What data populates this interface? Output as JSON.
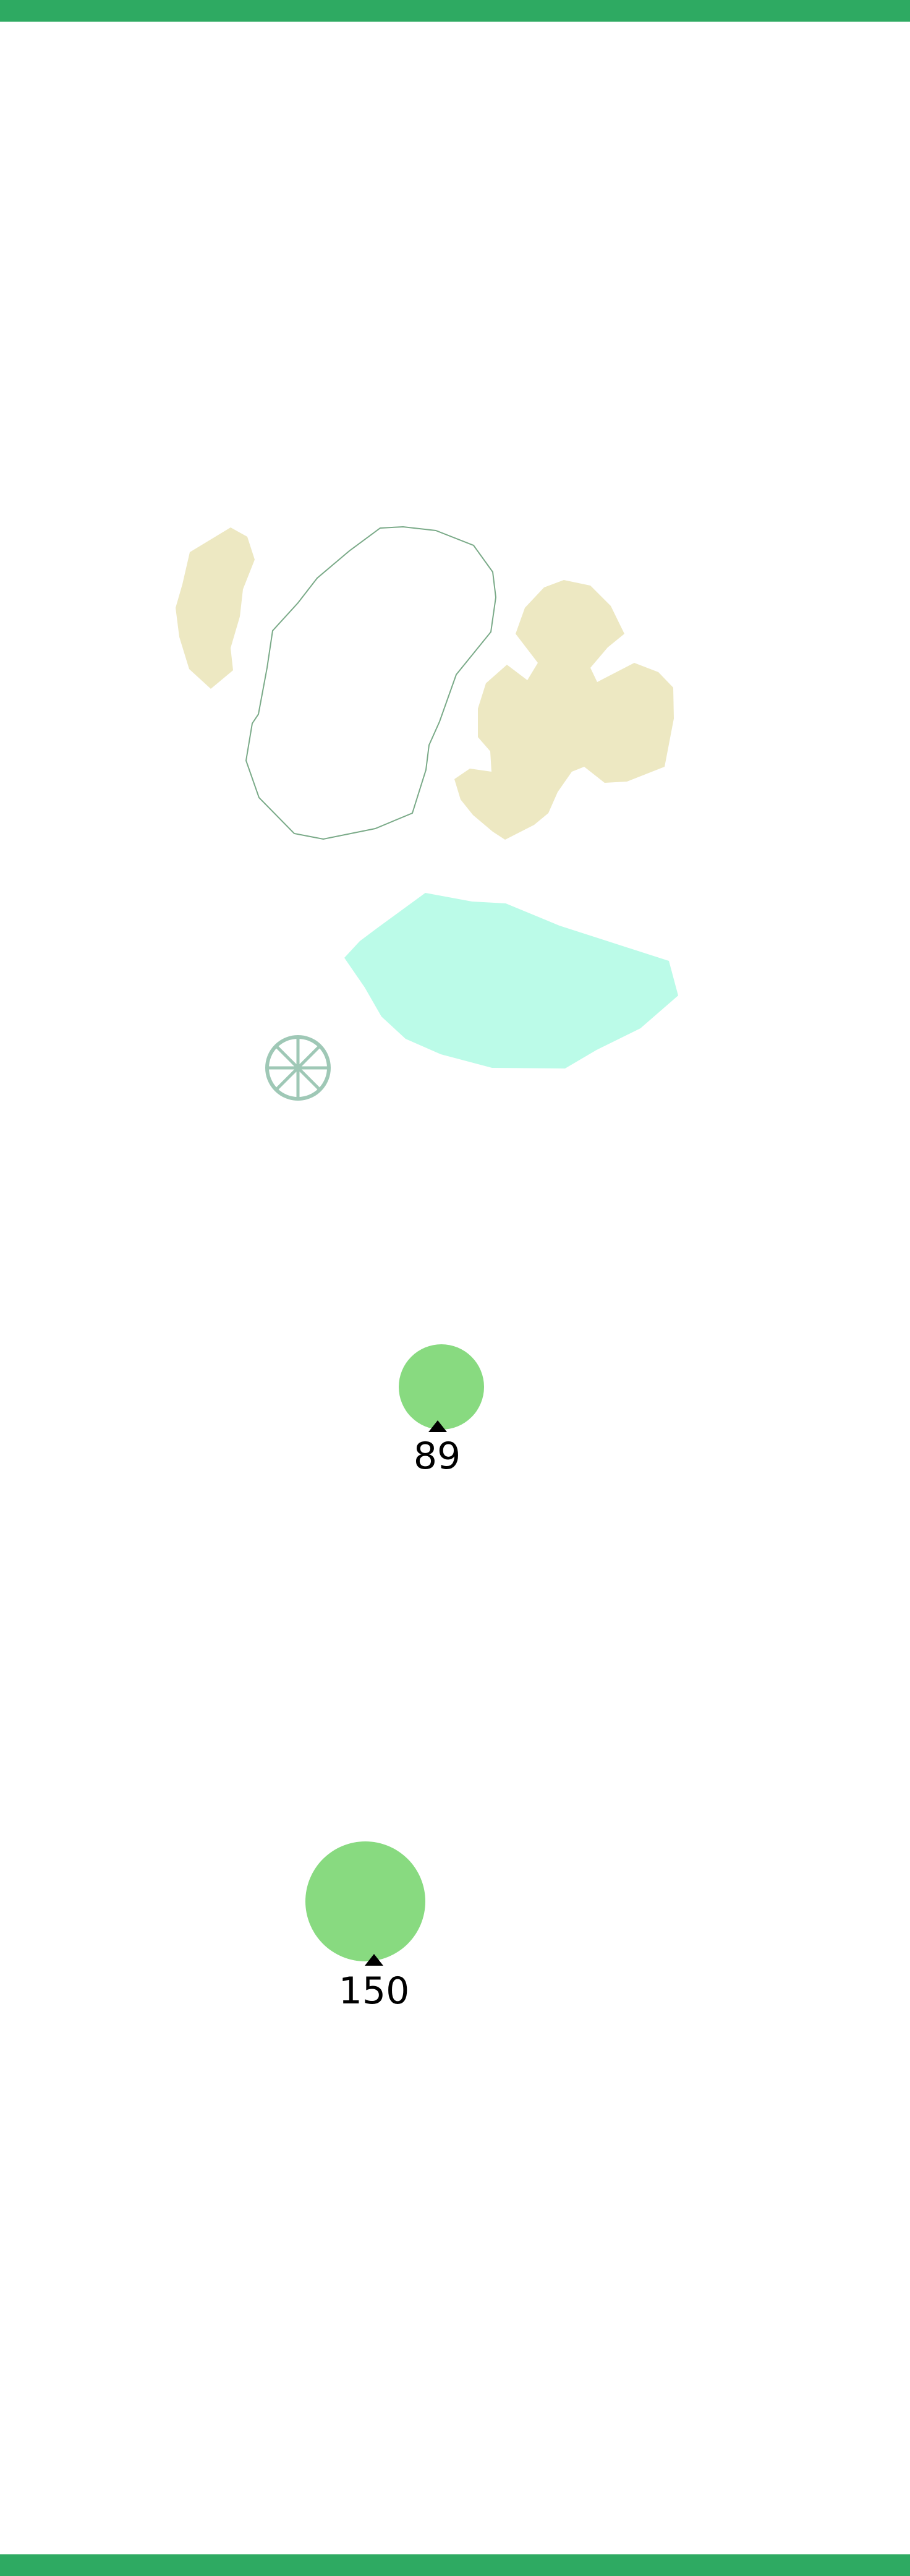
{
  "colors": {
    "band": "#2eaa62",
    "bunker": "#ede8c2",
    "water": "#bbfbe8",
    "green_outline": "#7aaa88",
    "tree": "#88da80",
    "sprinkler": "#9fc8b6",
    "marker": "#000000"
  },
  "icons": {
    "sprinkler": "sprinkler-head-icon",
    "distance_marker": "triangle-up-icon"
  },
  "distance_markers": [
    {
      "label": "89"
    },
    {
      "label": "150"
    }
  ]
}
